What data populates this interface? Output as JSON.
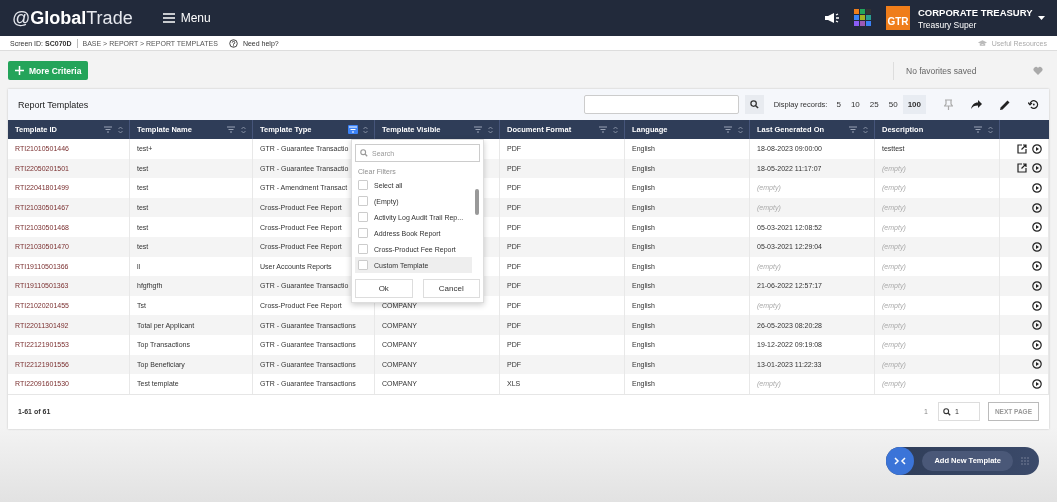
{
  "header": {
    "logo": "@**Global**Trade",
    "menu_label": "Menu",
    "org": {
      "badge": "GTR",
      "name": "CORPORATE TREASURY",
      "role": "Treasury Super"
    }
  },
  "breadcrumb": {
    "screen_label": "Screen ID:",
    "screen_id": "SC070D",
    "path": "BASE > REPORT > REPORT TEMPLATES",
    "help": "Need help?",
    "resources": "Useful Resources"
  },
  "toolbar": {
    "more_criteria": "More Criteria",
    "favorites": "No favorites saved"
  },
  "card": {
    "title": "Report Templates",
    "display_label": "Display records:",
    "page_sizes": [
      {
        "label": "5",
        "selected": false
      },
      {
        "label": "10",
        "selected": false
      },
      {
        "label": "25",
        "selected": false
      },
      {
        "label": "50",
        "selected": false
      },
      {
        "label": "100",
        "selected": true
      }
    ]
  },
  "table": {
    "columns": [
      {
        "label": "Template ID",
        "filter_active": false
      },
      {
        "label": "Template Name",
        "filter_active": false
      },
      {
        "label": "Template Type",
        "filter_active": true
      },
      {
        "label": "Template Visible",
        "filter_active": false
      },
      {
        "label": "Document Format",
        "filter_active": false
      },
      {
        "label": "Language",
        "filter_active": false
      },
      {
        "label": "Last Generated On",
        "filter_active": false
      },
      {
        "label": "Description",
        "filter_active": false
      }
    ],
    "rows": [
      {
        "cells": [
          "RTI21010501446",
          "test+",
          "GTR - Guarantee Transactio",
          null,
          "PDF",
          "English",
          "18-08-2023 09:00:00",
          "testtest"
        ],
        "editable": true
      },
      {
        "cells": [
          "RTI22050201501",
          "test",
          "GTR - Guarantee Transactio",
          null,
          "PDF",
          "English",
          "18-05-2022 11:17:07",
          "(empty)"
        ],
        "editable": true
      },
      {
        "cells": [
          "RTI22041801499",
          "test",
          "GTR - Amendment Transact",
          null,
          "PDF",
          "English",
          "(empty)",
          "(empty)"
        ],
        "editable": false
      },
      {
        "cells": [
          "RTI21030501467",
          "test",
          "Cross-Product Fee Report",
          null,
          "PDF",
          "English",
          "(empty)",
          "(empty)"
        ],
        "editable": false
      },
      {
        "cells": [
          "RTI21030501468",
          "test",
          "Cross-Product Fee Report",
          null,
          "PDF",
          "English",
          "05-03-2021 12:08:52",
          "(empty)"
        ],
        "editable": false
      },
      {
        "cells": [
          "RTI21030501470",
          "test",
          "Cross-Product Fee Report",
          null,
          "PDF",
          "English",
          "05-03-2021 12:29:04",
          "(empty)"
        ],
        "editable": false
      },
      {
        "cells": [
          "RTI19110501366",
          "ll",
          "User Accounts Reports",
          null,
          "PDF",
          "English",
          "(empty)",
          "(empty)"
        ],
        "editable": false
      },
      {
        "cells": [
          "RTI19110501363",
          "hfgfhgfh",
          "GTR - Guarantee Transactio",
          null,
          "PDF",
          "English",
          "21-06-2022 12:57:17",
          "(empty)"
        ],
        "editable": false
      },
      {
        "cells": [
          "RTI21020201455",
          "Tst",
          "Cross-Product Fee Report",
          "COMPANY",
          "PDF",
          "English",
          "(empty)",
          "(empty)"
        ],
        "editable": false
      },
      {
        "cells": [
          "RTI22011301492",
          "Total per Applicant",
          "GTR - Guarantee Transactions",
          "COMPANY",
          "PDF",
          "English",
          "26-05-2023 08:20:28",
          "(empty)"
        ],
        "editable": false
      },
      {
        "cells": [
          "RTI22121901553",
          "Top Transactions",
          "GTR - Guarantee Transactions",
          "COMPANY",
          "PDF",
          "English",
          "19-12-2022 09:19:08",
          "(empty)"
        ],
        "editable": false
      },
      {
        "cells": [
          "RTI22121901556",
          "Top Beneficiary",
          "GTR - Guarantee Transactions",
          "COMPANY",
          "PDF",
          "English",
          "13-01-2023 11:22:33",
          "(empty)"
        ],
        "editable": false
      },
      {
        "cells": [
          "RTI22091601530",
          "Test template",
          "GTR - Guarantee Transactions",
          "COMPANY",
          "XLS",
          "English",
          "(empty)",
          "(empty)"
        ],
        "editable": false
      }
    ]
  },
  "filter_menu": {
    "search_placeholder": "Search",
    "clear": "Clear Filters",
    "options": [
      {
        "label": "Select all",
        "checked": false,
        "hovered": false
      },
      {
        "label": "(Empty)",
        "checked": false,
        "hovered": false
      },
      {
        "label": "Activity Log Audit Trail Rep...",
        "checked": false,
        "hovered": false
      },
      {
        "label": "Address Book Report",
        "checked": false,
        "hovered": false
      },
      {
        "label": "Cross-Product Fee Report",
        "checked": false,
        "hovered": false
      },
      {
        "label": "Custom Template",
        "checked": false,
        "hovered": true
      }
    ],
    "ok": "Ok",
    "cancel": "Cancel"
  },
  "footer": {
    "count": "1-61 of 61",
    "page": "1",
    "page_input": "1",
    "next": "NEXT PAGE"
  },
  "fab": {
    "label": "Add New Template"
  }
}
